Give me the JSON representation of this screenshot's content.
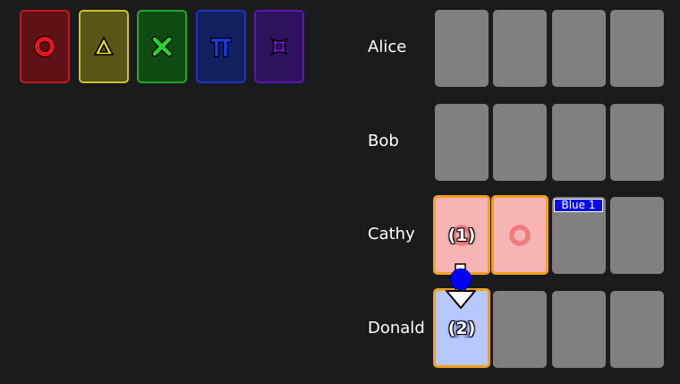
{
  "suits": [
    {
      "name": "red",
      "icon": "red-ring-icon",
      "color": "#e8141f",
      "bg": "#5e1215",
      "border": "#c9151c"
    },
    {
      "name": "yellow",
      "icon": "yellow-triangle-icon",
      "color": "#ece128",
      "bg": "#585517",
      "border": "#cbc226"
    },
    {
      "name": "green",
      "icon": "green-x-icon",
      "color": "#2bd12b",
      "bg": "#0f4a12",
      "border": "#21a621"
    },
    {
      "name": "blue",
      "icon": "blue-pi-icon",
      "color": "#1d36e8",
      "bg": "#132060",
      "border": "#1c34c8"
    },
    {
      "name": "purple",
      "icon": "purple-square-icon",
      "color": "#7a1ae3",
      "bg": "#2f125e",
      "border": "#5d16b3"
    }
  ],
  "players": [
    {
      "name": "Alice"
    },
    {
      "name": "Bob"
    },
    {
      "name": "Cathy"
    },
    {
      "name": "Donald"
    }
  ],
  "hands": {
    "cathy": {
      "card1_order": "(1)",
      "note": "Blue 1"
    },
    "donald": {
      "card1_order": "(2)"
    }
  },
  "colors": {
    "clue_border": "#f59f1d",
    "red_clued": "#f7b4b4",
    "blue_clued": "#b9c7ff",
    "blank_card": "#808080",
    "arrow_dot": "#0000ff"
  }
}
